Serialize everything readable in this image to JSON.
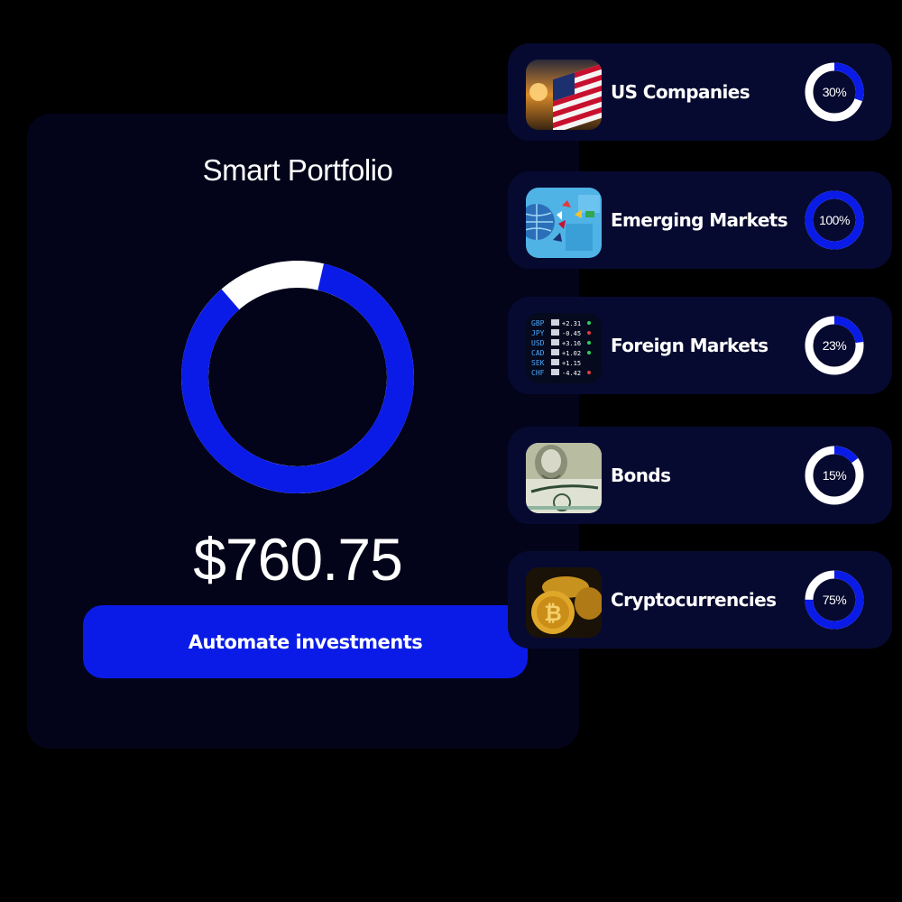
{
  "portfolio": {
    "title": "Smart Portfolio",
    "amount": "$760.75",
    "button_label": "Automate investments",
    "ring_fraction": 0.85
  },
  "colors": {
    "accent": "#0a1be8",
    "ring_track": "#ffffff",
    "card_bg": "#03041a",
    "asset_card_bg": "#070a30"
  },
  "assets": [
    {
      "name": "US Companies",
      "percent": "30%",
      "fraction": 0.3,
      "icon": "us-flag-icon"
    },
    {
      "name": "Emerging Markets",
      "percent": "100%",
      "fraction": 1.0,
      "icon": "globe-map-icon"
    },
    {
      "name": "Foreign Markets",
      "percent": "23%",
      "fraction": 0.23,
      "icon": "currency-board-icon"
    },
    {
      "name": "Bonds",
      "percent": "15%",
      "fraction": 0.15,
      "icon": "dollar-bill-icon"
    },
    {
      "name": "Cryptocurrencies",
      "percent": "75%",
      "fraction": 0.75,
      "icon": "bitcoin-coins-icon"
    }
  ]
}
